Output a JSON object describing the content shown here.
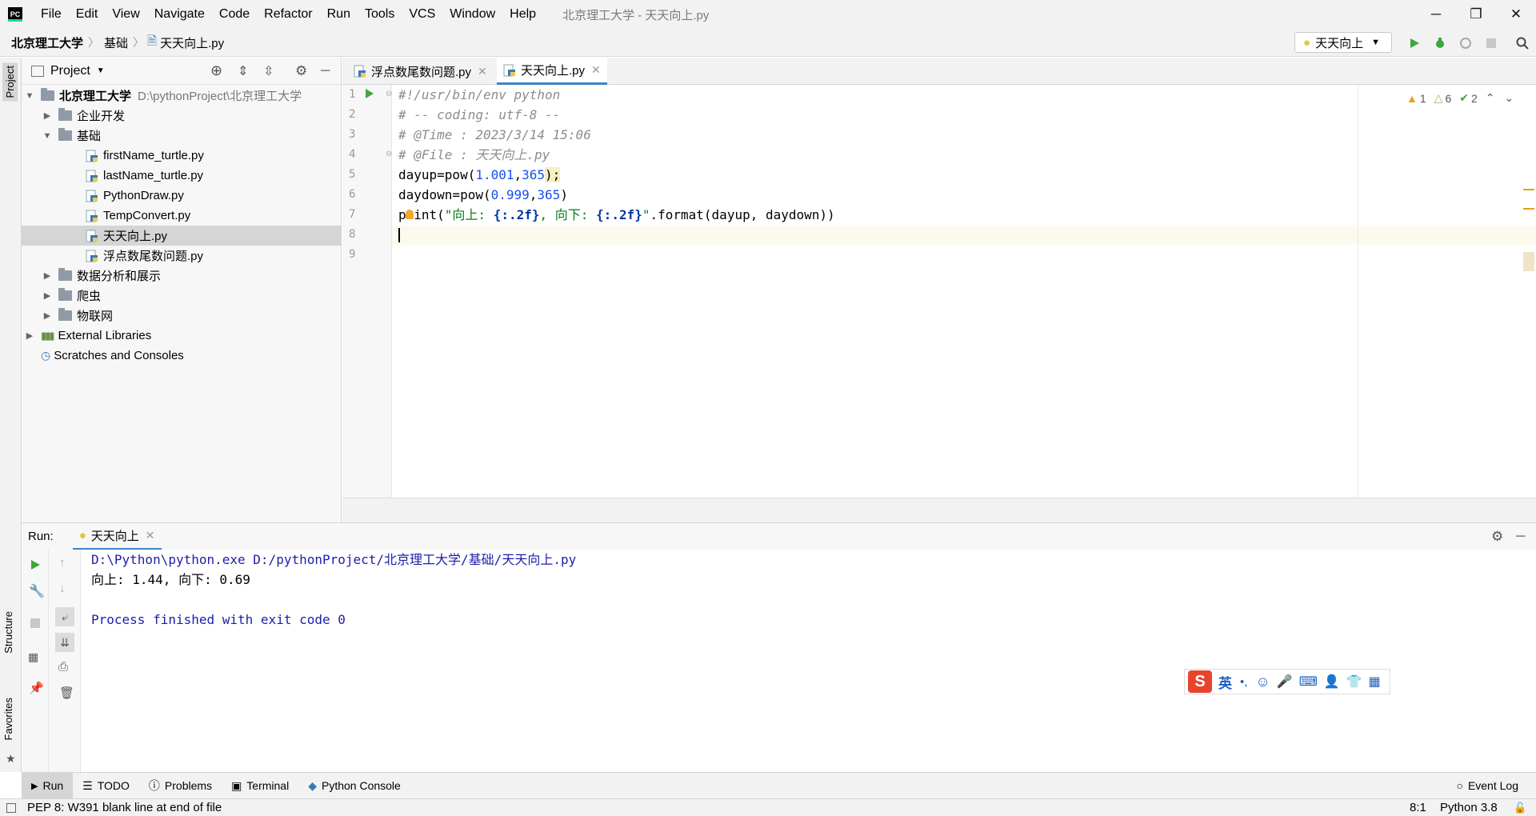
{
  "window": {
    "title": "北京理工大学 - 天天向上.py"
  },
  "menu": [
    "File",
    "Edit",
    "View",
    "Navigate",
    "Code",
    "Refactor",
    "Run",
    "Tools",
    "VCS",
    "Window",
    "Help"
  ],
  "breadcrumb": [
    "北京理工大学",
    "基础",
    "天天向上.py"
  ],
  "run_config": "天天向上",
  "side_tabs": {
    "project": "Project",
    "structure": "Structure",
    "favorites": "Favorites"
  },
  "project": {
    "title": "Project",
    "root": {
      "name": "北京理工大学",
      "path": "D:\\pythonProject\\北京理工大学"
    },
    "items": [
      {
        "label": "企业开发",
        "type": "folder",
        "depth": 1,
        "expanded": false
      },
      {
        "label": "基础",
        "type": "folder",
        "depth": 1,
        "expanded": true
      },
      {
        "label": "firstName_turtle.py",
        "type": "py",
        "depth": 2
      },
      {
        "label": "lastName_turtle.py",
        "type": "py",
        "depth": 2
      },
      {
        "label": "PythonDraw.py",
        "type": "py",
        "depth": 2
      },
      {
        "label": "TempConvert.py",
        "type": "py",
        "depth": 2
      },
      {
        "label": "天天向上.py",
        "type": "py",
        "depth": 2,
        "selected": true
      },
      {
        "label": "浮点数尾数问题.py",
        "type": "py",
        "depth": 2
      },
      {
        "label": "数据分析和展示",
        "type": "folder",
        "depth": 1,
        "expanded": false
      },
      {
        "label": "爬虫",
        "type": "folder",
        "depth": 1,
        "expanded": false
      },
      {
        "label": "物联网",
        "type": "folder",
        "depth": 1,
        "expanded": false
      }
    ],
    "external": "External Libraries",
    "scratches": "Scratches and Consoles"
  },
  "editor": {
    "tabs": [
      {
        "label": "浮点数尾数问题.py",
        "active": false
      },
      {
        "label": "天天向上.py",
        "active": true
      }
    ],
    "line_numbers": [
      "1",
      "2",
      "3",
      "4",
      "5",
      "6",
      "7",
      "8",
      "9"
    ],
    "lines": {
      "l1": "#!/usr/bin/env python",
      "l2": "# -- coding: utf-8 --",
      "l3": "# @Time : 2023/3/14 15:06",
      "l4": "# @File : 天天向上.py",
      "l5": {
        "a": "dayup=pow(",
        "n1": "1.001",
        "c": ",",
        "n2": "365",
        "d": ");"
      },
      "l6": {
        "a": "daydown=pow(",
        "n1": "0.999",
        "c": ",",
        "n2": "365",
        "d": ")"
      },
      "l7": {
        "a": "print(",
        "s1": "\"向上: ",
        "f1": "{:.2f}",
        "s2": ", 向下: ",
        "f2": "{:.2f}",
        "s3": "\"",
        "d": ".format(dayup, daydown))"
      }
    },
    "inspections": {
      "warnings": "1",
      "weak": "6",
      "typos": "2"
    }
  },
  "run": {
    "label": "Run:",
    "tab": "天天向上",
    "output": [
      "D:\\Python\\python.exe D:/pythonProject/北京理工大学/基础/天天向上.py",
      "向上: 1.44, 向下: 0.69",
      "",
      "Process finished with exit code 0"
    ]
  },
  "ime": {
    "mode": "英"
  },
  "tool_windows": [
    "Run",
    "TODO",
    "Problems",
    "Terminal",
    "Python Console"
  ],
  "event_log": "Event Log",
  "status": {
    "message": "PEP 8: W391 blank line at end of file",
    "position": "8:1",
    "interpreter": "Python 3.8"
  }
}
